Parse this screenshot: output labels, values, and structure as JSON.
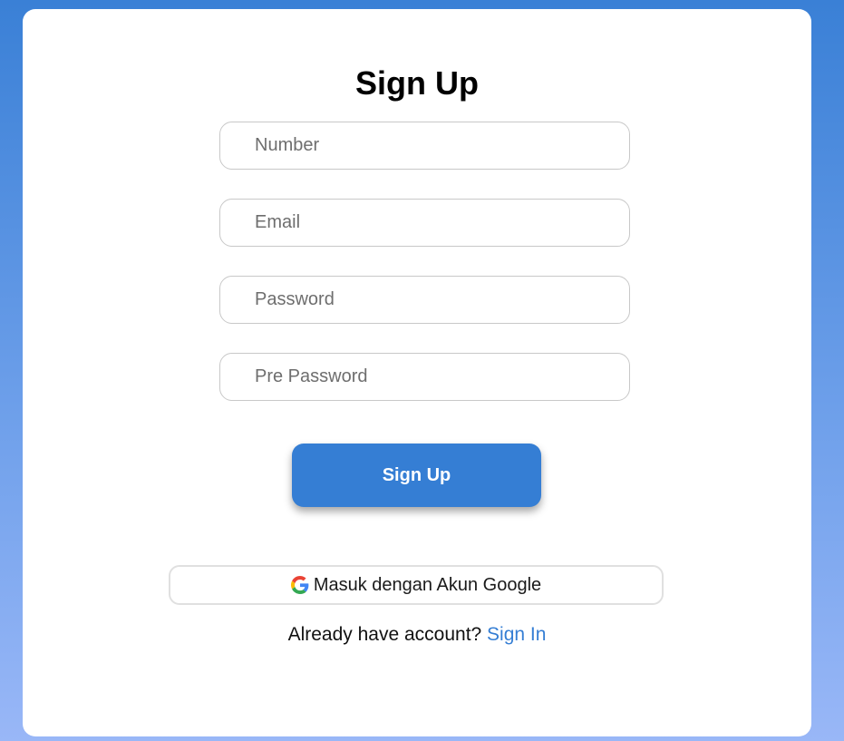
{
  "form": {
    "title": "Sign Up",
    "fields": [
      {
        "placeholder": "Number",
        "value": ""
      },
      {
        "placeholder": "Email",
        "value": ""
      },
      {
        "placeholder": "Password",
        "value": ""
      },
      {
        "placeholder": "Pre Password",
        "value": ""
      }
    ],
    "submit_label": "Sign Up",
    "google_label": "Masuk dengan Akun Google",
    "footer_text": "Already have account?",
    "signin_label": "Sign In"
  },
  "colors": {
    "accent": "#357ed4",
    "background_top": "#3a80d6",
    "background_bottom": "#99b7f7"
  },
  "icons": {
    "google": "google-icon"
  }
}
